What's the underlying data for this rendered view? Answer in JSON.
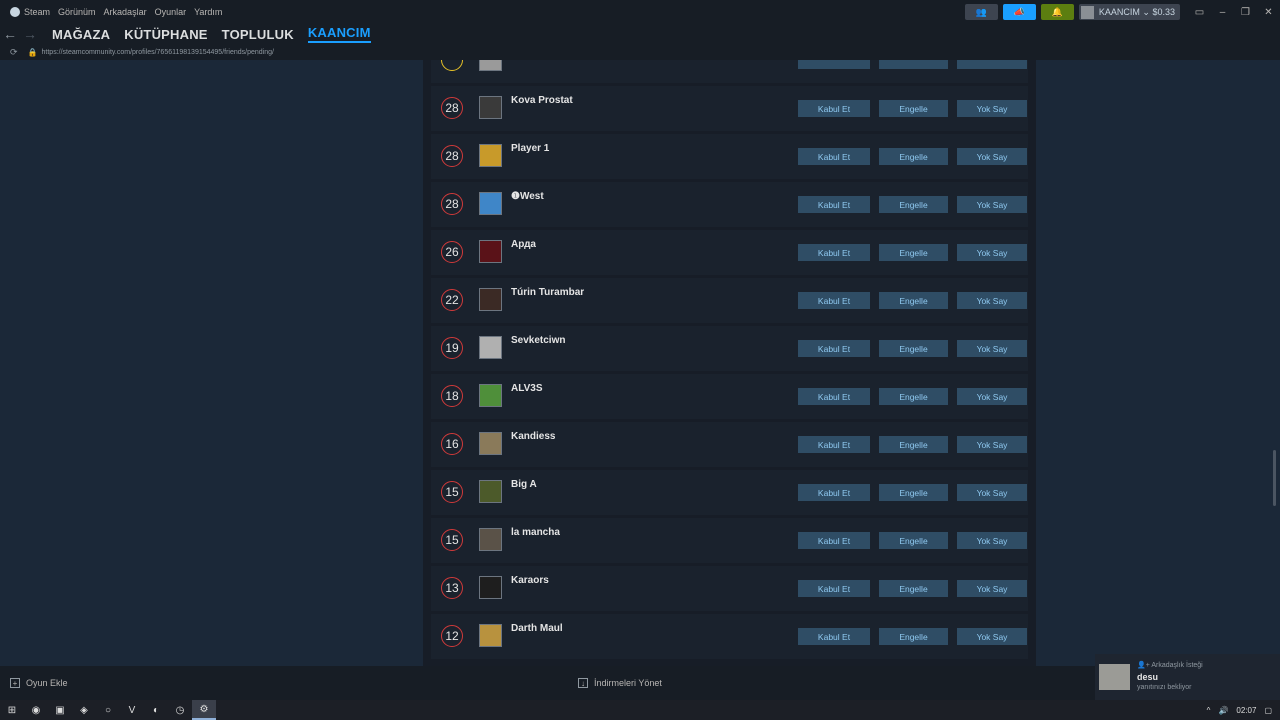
{
  "menu": {
    "items": [
      "Steam",
      "Görünüm",
      "Arkadaşlar",
      "Oyunlar",
      "Yardım"
    ],
    "account_name": "KAANCIM",
    "balance": "$0.33"
  },
  "nav": {
    "store": "MAĞAZA",
    "library": "KÜTÜPHANE",
    "community": "TOPLULUK",
    "profile": "KAANCIM"
  },
  "url": "https://steamcommunity.com/profiles/76561198139154495/friends/pending/",
  "buttons": {
    "accept": "Kabul Et",
    "block": "Engelle",
    "ignore": "Yok Say"
  },
  "partial_row": {
    "level": "",
    "level_color": "#e8c327"
  },
  "requests": [
    {
      "level": "28",
      "name": "Kova Prostat",
      "avatar_color": "#3a3a3a"
    },
    {
      "level": "28",
      "name": "Player 1",
      "avatar_color": "#c89a2a"
    },
    {
      "level": "28",
      "name": "❶West",
      "avatar_color": "#3f86c8"
    },
    {
      "level": "26",
      "name": "Арда",
      "avatar_color": "#5a1218"
    },
    {
      "level": "22",
      "name": "Túrin Turambar",
      "avatar_color": "#3b2a25"
    },
    {
      "level": "19",
      "name": "Sevketciwn",
      "avatar_color": "#b0b0b0"
    },
    {
      "level": "18",
      "name": "ALV3S",
      "avatar_color": "#4f8f3a"
    },
    {
      "level": "16",
      "name": "Kandiess",
      "avatar_color": "#8a7a5a"
    },
    {
      "level": "15",
      "name": "Big A",
      "avatar_color": "#4c5a2a"
    },
    {
      "level": "15",
      "name": "la mancha",
      "avatar_color": "#5a5248"
    },
    {
      "level": "13",
      "name": "Karaors",
      "avatar_color": "#1e1e1e"
    },
    {
      "level": "12",
      "name": "Darth Maul",
      "avatar_color": "#b8923e"
    }
  ],
  "bottom": {
    "add_game": "Oyun Ekle",
    "downloads": "İndirmeleri Yönet"
  },
  "notification": {
    "title": "Arkadaşlık İsteği",
    "name": "desu",
    "subtitle": "yanıtınızı bekliyor"
  },
  "taskbar": {
    "time": "02:07"
  },
  "colors": {
    "accent": "#1a9fff",
    "level_ring": "#d13a3a",
    "button_bg": "#2f4d65",
    "button_text": "#8fc9f0"
  }
}
